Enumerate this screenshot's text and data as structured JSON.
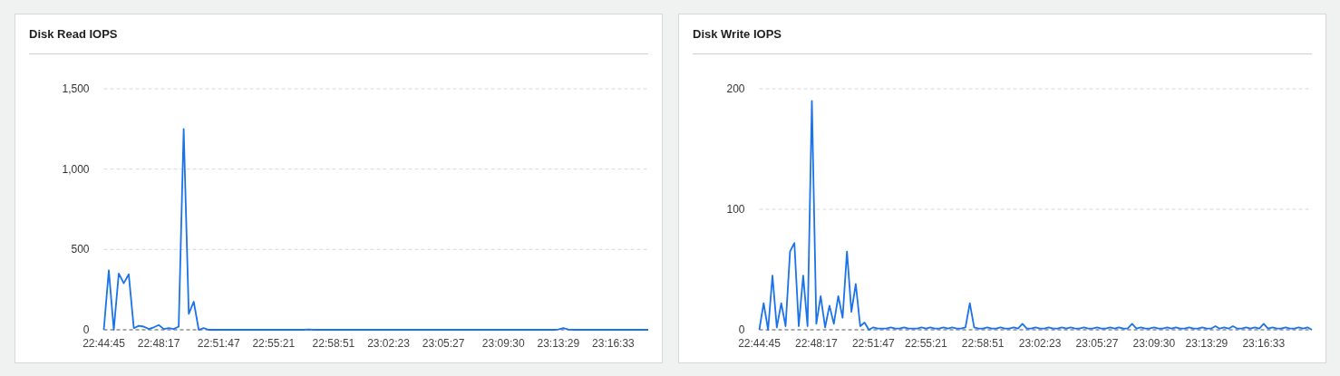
{
  "panels": [
    {
      "title": "Disk Read IOPS",
      "chart_data": {
        "type": "line",
        "ylim": [
          0,
          1500
        ],
        "yticks": [
          {
            "value": 0,
            "label": "0"
          },
          {
            "value": 500,
            "label": "500"
          },
          {
            "value": 1000,
            "label": "1,000"
          },
          {
            "value": 1500,
            "label": "1,500"
          }
        ],
        "categories": [
          "22:44:45",
          null,
          null,
          null,
          null,
          null,
          null,
          null,
          null,
          null,
          null,
          "22:48:17",
          null,
          null,
          null,
          null,
          null,
          null,
          null,
          null,
          null,
          null,
          null,
          "22:51:47",
          null,
          null,
          null,
          null,
          null,
          null,
          null,
          null,
          null,
          null,
          "22:55:21",
          null,
          null,
          null,
          null,
          null,
          null,
          null,
          null,
          null,
          null,
          null,
          "22:58:51",
          null,
          null,
          null,
          null,
          null,
          null,
          null,
          null,
          null,
          null,
          "23:02:23",
          null,
          null,
          null,
          null,
          null,
          null,
          null,
          null,
          null,
          null,
          "23:05:27",
          null,
          null,
          null,
          null,
          null,
          null,
          null,
          null,
          null,
          null,
          null,
          "23:09:30",
          null,
          null,
          null,
          null,
          null,
          null,
          null,
          null,
          null,
          null,
          "23:13:29",
          null,
          null,
          null,
          null,
          null,
          null,
          null,
          null,
          null,
          null,
          "23:16:33",
          null,
          null,
          null,
          null,
          null,
          null,
          null
        ],
        "series": [
          {
            "color": "#1a73e8",
            "values": [
              0,
              370,
              0,
              350,
              290,
              345,
              10,
              25,
              20,
              5,
              15,
              30,
              5,
              10,
              5,
              20,
              1250,
              100,
              175,
              0,
              10,
              0,
              0,
              0,
              0,
              0,
              0,
              0,
              0,
              0,
              0,
              0,
              0,
              0,
              0,
              0,
              0,
              0,
              0,
              0,
              0,
              2,
              0,
              0,
              0,
              0,
              0,
              0,
              0,
              0,
              0,
              0,
              0,
              0,
              0,
              0,
              0,
              0,
              0,
              0,
              0,
              0,
              0,
              0,
              0,
              0,
              0,
              0,
              0,
              0,
              0,
              0,
              0,
              0,
              0,
              0,
              0,
              0,
              0,
              0,
              0,
              0,
              0,
              0,
              0,
              0,
              0,
              0,
              0,
              0,
              0,
              2,
              10,
              2,
              0,
              0,
              0,
              0,
              0,
              0,
              0,
              0,
              0,
              0,
              0,
              0,
              0,
              0,
              0,
              0
            ]
          }
        ]
      }
    },
    {
      "title": "Disk Write IOPS",
      "chart_data": {
        "type": "line",
        "ylim": [
          0,
          200
        ],
        "yticks": [
          {
            "value": 0,
            "label": "0"
          },
          {
            "value": 100,
            "label": "100"
          },
          {
            "value": 200,
            "label": "200"
          }
        ],
        "categories": [
          "22:44:45",
          null,
          null,
          null,
          null,
          null,
          null,
          null,
          null,
          null,
          null,
          null,
          null,
          "22:48:17",
          null,
          null,
          null,
          null,
          null,
          null,
          null,
          null,
          null,
          null,
          null,
          null,
          "22:51:47",
          null,
          null,
          null,
          null,
          null,
          null,
          null,
          null,
          null,
          null,
          null,
          "22:55:21",
          null,
          null,
          null,
          null,
          null,
          null,
          null,
          null,
          null,
          null,
          null,
          null,
          "22:58:51",
          null,
          null,
          null,
          null,
          null,
          null,
          null,
          null,
          null,
          null,
          null,
          null,
          "23:02:23",
          null,
          null,
          null,
          null,
          null,
          null,
          null,
          null,
          null,
          null,
          null,
          null,
          "23:05:27",
          null,
          null,
          null,
          null,
          null,
          null,
          null,
          null,
          null,
          null,
          null,
          null,
          "23:09:30",
          null,
          null,
          null,
          null,
          null,
          null,
          null,
          null,
          null,
          null,
          null,
          "23:13:29",
          null,
          null,
          null,
          null,
          null,
          null,
          null,
          null,
          null,
          null,
          null,
          null,
          "23:16:33",
          null,
          null,
          null,
          null,
          null,
          null,
          null,
          null,
          null,
          null,
          null
        ],
        "series": [
          {
            "color": "#1a73e8",
            "values": [
              0,
              22,
              0,
              45,
              2,
              22,
              3,
              65,
              72,
              3,
              45,
              3,
              190,
              5,
              28,
              2,
              20,
              5,
              28,
              10,
              65,
              15,
              38,
              3,
              6,
              0,
              2,
              1,
              1,
              1,
              2,
              1,
              1,
              2,
              1,
              1,
              1,
              2,
              1,
              2,
              1,
              1,
              2,
              1,
              2,
              1,
              1,
              2,
              22,
              2,
              1,
              1,
              2,
              1,
              1,
              2,
              1,
              1,
              2,
              1,
              5,
              1,
              1,
              2,
              1,
              1,
              2,
              1,
              1,
              2,
              1,
              2,
              1,
              1,
              2,
              1,
              1,
              2,
              1,
              1,
              2,
              1,
              2,
              1,
              1,
              5,
              1,
              2,
              1,
              1,
              2,
              1,
              1,
              2,
              1,
              2,
              1,
              1,
              2,
              1,
              1,
              2,
              1,
              1,
              3,
              1,
              2,
              1,
              3,
              1,
              1,
              2,
              1,
              2,
              1,
              5,
              1,
              2,
              1,
              1,
              2,
              1,
              1,
              2,
              1,
              2,
              0
            ]
          }
        ]
      }
    }
  ]
}
